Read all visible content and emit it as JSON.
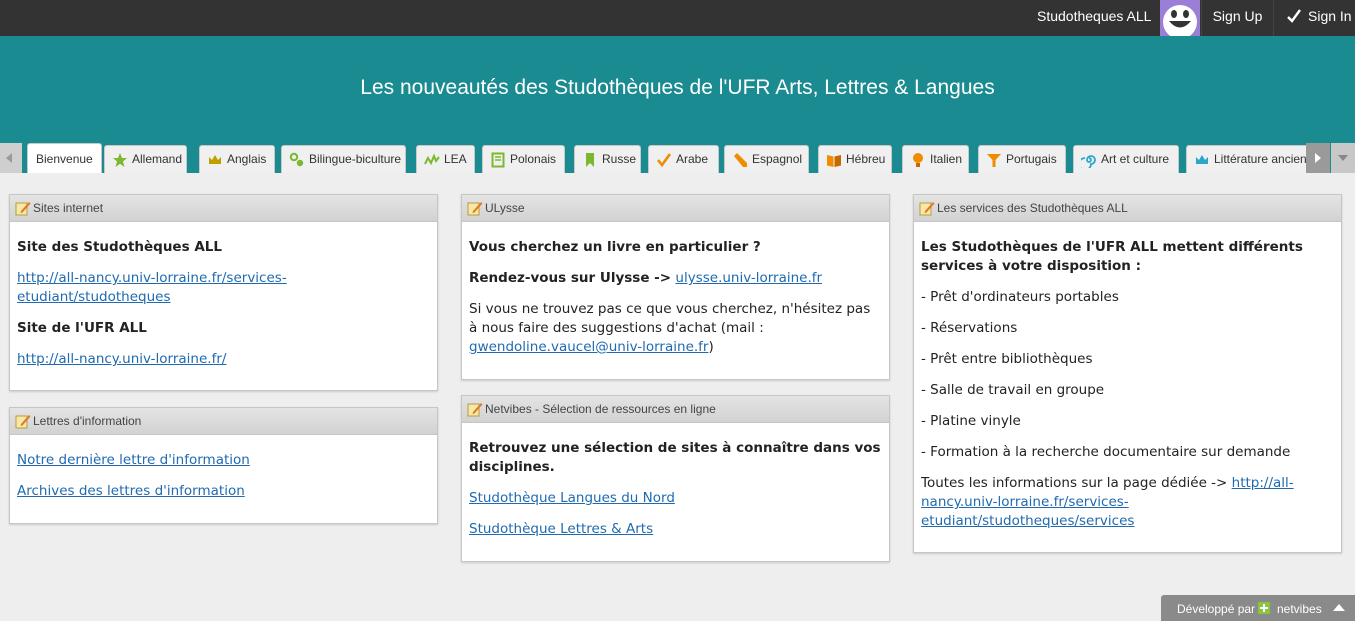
{
  "topbar": {
    "brand": "Studotheques ALL",
    "signup_label": "Sign Up",
    "signin_label": "Sign In"
  },
  "header": {
    "title": "Les nouveautés des Studothèques de l'UFR Arts, Lettres & Langues"
  },
  "tabs": [
    {
      "label": "Bienvenue",
      "icon": "none",
      "active": true
    },
    {
      "label": "Allemand",
      "icon": "star-icon",
      "color": "#7cb82f"
    },
    {
      "label": "Anglais",
      "icon": "crown-icon",
      "color": "#c0a000"
    },
    {
      "label": "Bilingue-biculture",
      "icon": "molecule-icon",
      "color": "#7cb82f"
    },
    {
      "label": "LEA",
      "icon": "chart-line-icon",
      "color": "#7cb82f"
    },
    {
      "label": "Polonais",
      "icon": "book-icon",
      "color": "#7cb82f"
    },
    {
      "label": "Russe",
      "icon": "bookmark-icon",
      "color": "#7cb82f"
    },
    {
      "label": "Arabe",
      "icon": "checkmark-icon",
      "color": "#f08c00"
    },
    {
      "label": "Espagnol",
      "icon": "pencil-icon",
      "color": "#f08c00"
    },
    {
      "label": "Hébreu",
      "icon": "open-book-icon",
      "color": "#f08c00"
    },
    {
      "label": "Italien",
      "icon": "lightbulb-icon",
      "color": "#f08c00"
    },
    {
      "label": "Portugais",
      "icon": "funnel-icon",
      "color": "#f08c00"
    },
    {
      "label": "Art et culture",
      "icon": "spiral-icon",
      "color": "#2aa6c9"
    },
    {
      "label": "Littérature ancienne",
      "icon": "crown-icon",
      "color": "#2aa6c9"
    }
  ],
  "widgets": {
    "sites": {
      "title": "Sites internet",
      "heading1": "Site des Studothèques ALL",
      "link1": "http://all-nancy.univ-lorraine.fr/services-etudiant/studotheques",
      "heading2": "Site de l'UFR ALL",
      "link2": "http://all-nancy.univ-lorraine.fr/"
    },
    "lettres": {
      "title": "Lettres d'information",
      "link1": "Notre dernière lettre d'information",
      "link2": "Archives des lettres d'information"
    },
    "ulysse": {
      "title": "ULysse",
      "line1": "Vous cherchez un livre en particulier ?",
      "line2_prefix": "Rendez-vous sur Ulysse ->",
      "line2_link": "ulysse.univ-lorraine.fr",
      "line3": "Si vous ne trouvez pas ce que vous cherchez, n'hésitez pas à nous faire des suggestions d'achat (mail :",
      "line3_link": "gwendoline.vaucel@univ-lorraine.fr",
      "line3_suffix": ")"
    },
    "netvibes": {
      "title": "Netvibes - Sélection de ressources en ligne",
      "intro": "Retrouvez une sélection de sites à connaître dans vos disciplines.",
      "link1": "Studothèque Langues du Nord",
      "link2": "Studothèque Lettres & Arts"
    },
    "services": {
      "title": "Les services des Studothèques ALL",
      "intro": "Les Studothèques de l'UFR ALL mettent différents services à votre disposition :",
      "items": [
        "- Prêt d'ordinateurs portables",
        "- Réservations",
        "- Prêt entre bibliothèques",
        "- Salle de travail en groupe",
        "- Platine vinyle",
        "- Formation à la recherche documentaire sur demande"
      ],
      "outro_prefix": "Toutes les informations sur la page dédiée ->",
      "outro_link": "http://all-nancy.univ-lorraine.fr/services-etudiant/studotheques/services"
    }
  },
  "footer": {
    "prefix": "Développé par",
    "brand": "netvibes"
  },
  "colors": {
    "header_teal": "#1a8b91",
    "topbar": "#333333",
    "avatar": "#9b7fd6",
    "link": "#1f6ab0"
  }
}
